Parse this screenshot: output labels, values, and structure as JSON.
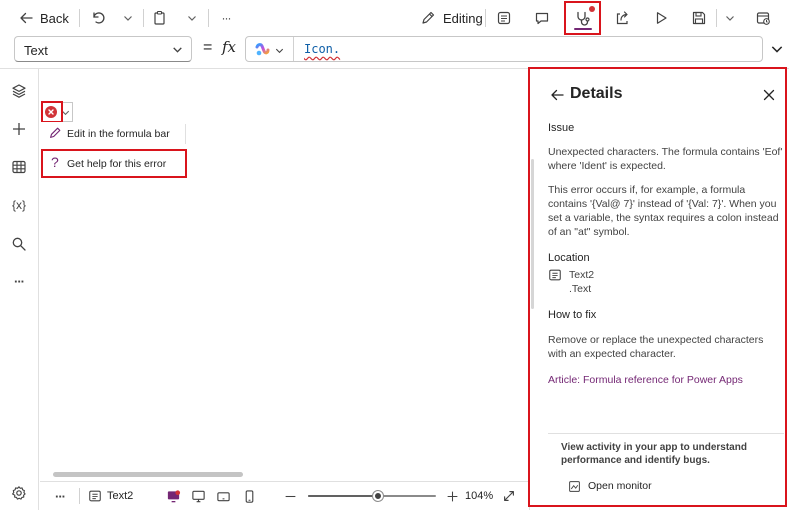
{
  "toolbar": {
    "back_label": "Back",
    "more_label": "···",
    "editing_label": "Editing"
  },
  "formula": {
    "property": "Text",
    "equals": "=",
    "fx": "fx",
    "value": "Icon."
  },
  "left_rail": {
    "variables_label": "{x}",
    "more_label": "···"
  },
  "canvas": {
    "menu": {
      "edit_label": "Edit in the formula bar",
      "help_label": "Get help for this error"
    }
  },
  "status_bar": {
    "more_label": "···",
    "screen_label": "Text2",
    "zoom_value": 0.55,
    "zoom_label": "104%"
  },
  "details": {
    "title": "Details",
    "issue_heading": "Issue",
    "issue_text": "Unexpected characters. The formula contains 'Eof' where 'Ident' is expected.",
    "explanation": "This error occurs if, for example, a formula contains '{Val@ 7}' instead of '{Val: 7}'. When you set a variable, the syntax requires a colon instead of an \"at\" symbol.",
    "location_heading": "Location",
    "location_control": "Text2",
    "location_property": ".Text",
    "howtofix_heading": "How to fix",
    "howtofix_text": "Remove or replace the unexpected characters with an expected character.",
    "article_link": "Article: Formula reference for Power Apps",
    "monitor_text": "View activity in your app to understand performance and identify bugs.",
    "monitor_button": "Open monitor"
  },
  "colors": {
    "accent": "#742774",
    "error_red": "#d13438",
    "highlight_red": "#d9141c"
  }
}
